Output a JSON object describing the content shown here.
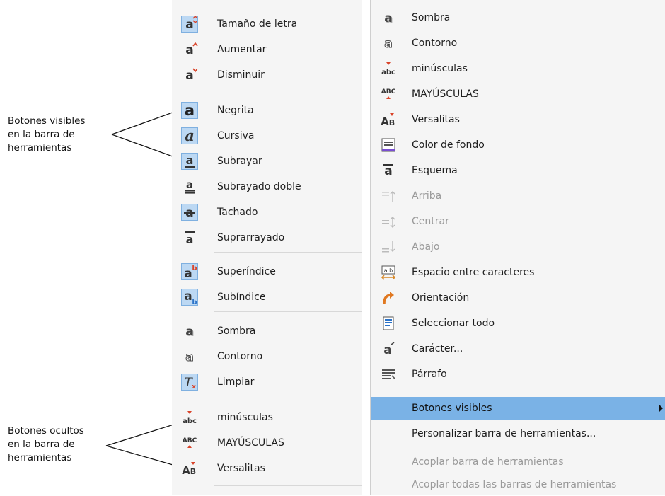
{
  "annotations": {
    "visible": [
      "Botones visibles",
      "en la barra de",
      "herramientas"
    ],
    "hidden": [
      "Botones ocultos",
      "en la barra de",
      "herramientas"
    ]
  },
  "left_menu": [
    {
      "label": "Tamaño de letra",
      "icon": "font-size-icon",
      "active": true
    },
    {
      "label": "Aumentar",
      "icon": "font-grow-icon",
      "active": false
    },
    {
      "label": "Disminuir",
      "icon": "font-shrink-icon",
      "active": false
    },
    {
      "label": "Negrita",
      "icon": "bold-icon",
      "active": true
    },
    {
      "label": "Cursiva",
      "icon": "italic-icon",
      "active": true
    },
    {
      "label": "Subrayar",
      "icon": "underline-icon",
      "active": true
    },
    {
      "label": "Subrayado doble",
      "icon": "double-underline-icon",
      "active": false
    },
    {
      "label": "Tachado",
      "icon": "strikethrough-icon",
      "active": true
    },
    {
      "label": "Suprarrayado",
      "icon": "overline-icon",
      "active": false
    },
    {
      "label": "Superíndice",
      "icon": "superscript-icon",
      "active": true
    },
    {
      "label": "Subíndice",
      "icon": "subscript-icon",
      "active": true
    },
    {
      "label": "Sombra",
      "icon": "shadow-icon",
      "active": false
    },
    {
      "label": "Contorno",
      "icon": "outline-icon",
      "active": false
    },
    {
      "label": "Limpiar",
      "icon": "clear-formatting-icon",
      "active": true
    },
    {
      "label": "minúsculas",
      "icon": "lowercase-icon",
      "active": false
    },
    {
      "label": "MAYÚSCULAS",
      "icon": "uppercase-icon",
      "active": false
    },
    {
      "label": "Versalitas",
      "icon": "small-caps-icon",
      "active": false
    }
  ],
  "right_menu": [
    {
      "label": "Sombra",
      "icon": "shadow-icon",
      "disabled": false
    },
    {
      "label": "Contorno",
      "icon": "outline-icon",
      "disabled": false
    },
    {
      "label": "minúsculas",
      "icon": "lowercase-icon",
      "disabled": false
    },
    {
      "label": "MAYÚSCULAS",
      "icon": "uppercase-icon",
      "disabled": false
    },
    {
      "label": "Versalitas",
      "icon": "small-caps-icon",
      "disabled": false
    },
    {
      "label": "Color de fondo",
      "icon": "background-color-icon",
      "disabled": false
    },
    {
      "label": "Esquema",
      "icon": "outline-numbering-icon",
      "disabled": false
    },
    {
      "label": "Arriba",
      "icon": "align-top-icon",
      "disabled": true
    },
    {
      "label": "Centrar",
      "icon": "align-center-vertical-icon",
      "disabled": true
    },
    {
      "label": "Abajo",
      "icon": "align-bottom-icon",
      "disabled": true
    },
    {
      "label": "Espacio entre caracteres",
      "icon": "character-spacing-icon",
      "disabled": false
    },
    {
      "label": "Orientación",
      "icon": "orientation-icon",
      "disabled": false
    },
    {
      "label": "Seleccionar todo",
      "icon": "select-all-icon",
      "disabled": false
    },
    {
      "label": "Carácter...",
      "icon": "character-icon",
      "disabled": false
    },
    {
      "label": "Párrafo",
      "icon": "paragraph-icon",
      "disabled": false
    },
    {
      "label": "Botones visibles",
      "highlighted": true,
      "submenu": true
    },
    {
      "label": "Personalizar barra de herramientas..."
    },
    {
      "label": "Acoplar barra de herramientas",
      "disabled": true
    },
    {
      "label": "Acoplar todas las barras de herramientas",
      "disabled": true
    }
  ],
  "colors": {
    "highlight": "#7ab2e6",
    "active_icon_bg": "#bcd8f3",
    "accent_red": "#d9442a",
    "disabled_text": "#9a9a9a"
  }
}
